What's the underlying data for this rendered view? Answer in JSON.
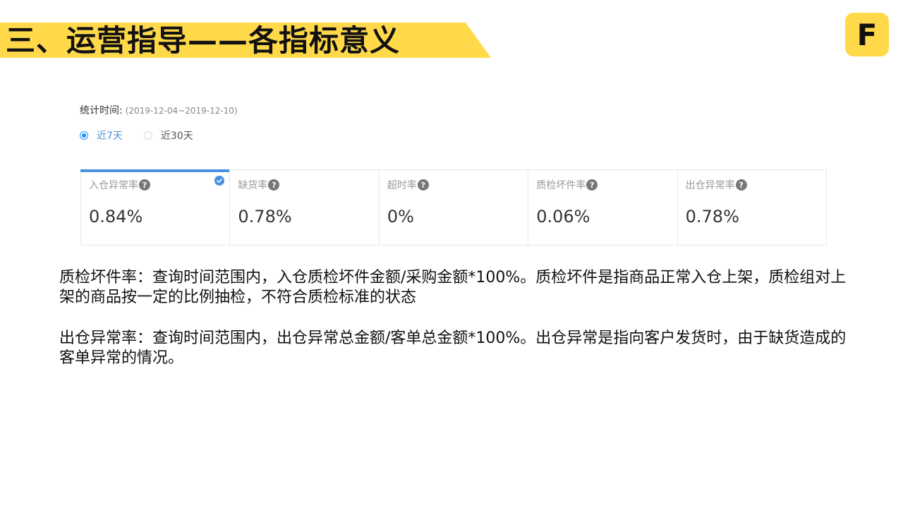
{
  "slide": {
    "title": "三、运营指导——各指标意义",
    "logo_letter": "F"
  },
  "stats": {
    "period_label": "统计时间:",
    "period_range": "(2019-12-04~2019-12-10)",
    "radio_options": [
      {
        "label": "近7天",
        "checked": true
      },
      {
        "label": "近30天",
        "checked": false
      }
    ]
  },
  "metrics": [
    {
      "label": "入仓异常率",
      "value": "0.84%",
      "selected": true
    },
    {
      "label": "缺货率",
      "value": "0.78%",
      "selected": false
    },
    {
      "label": "超时率",
      "value": "0%",
      "selected": false
    },
    {
      "label": "质检坏件率",
      "value": "0.06%",
      "selected": false
    },
    {
      "label": "出仓异常率",
      "value": "0.78%",
      "selected": false
    }
  ],
  "help_glyph": "?",
  "descriptions": [
    "质检坏件率：查询时间范围内，入仓质检坏件金额/采购金额*100%。质检坏件是指商品正常入仓上架，质检组对上架的商品按一定的比例抽检，不符合质检标准的状态",
    "出仓异常率：查询时间范围内，出仓异常总金额/客单总金额*100%。出仓异常是指向客户发货时，由于缺货造成的客单异常的情况。"
  ],
  "colors": {
    "banner_yellow": "#FFD94A",
    "accent_blue": "#4a90e2",
    "radio_blue": "#1890ff"
  }
}
